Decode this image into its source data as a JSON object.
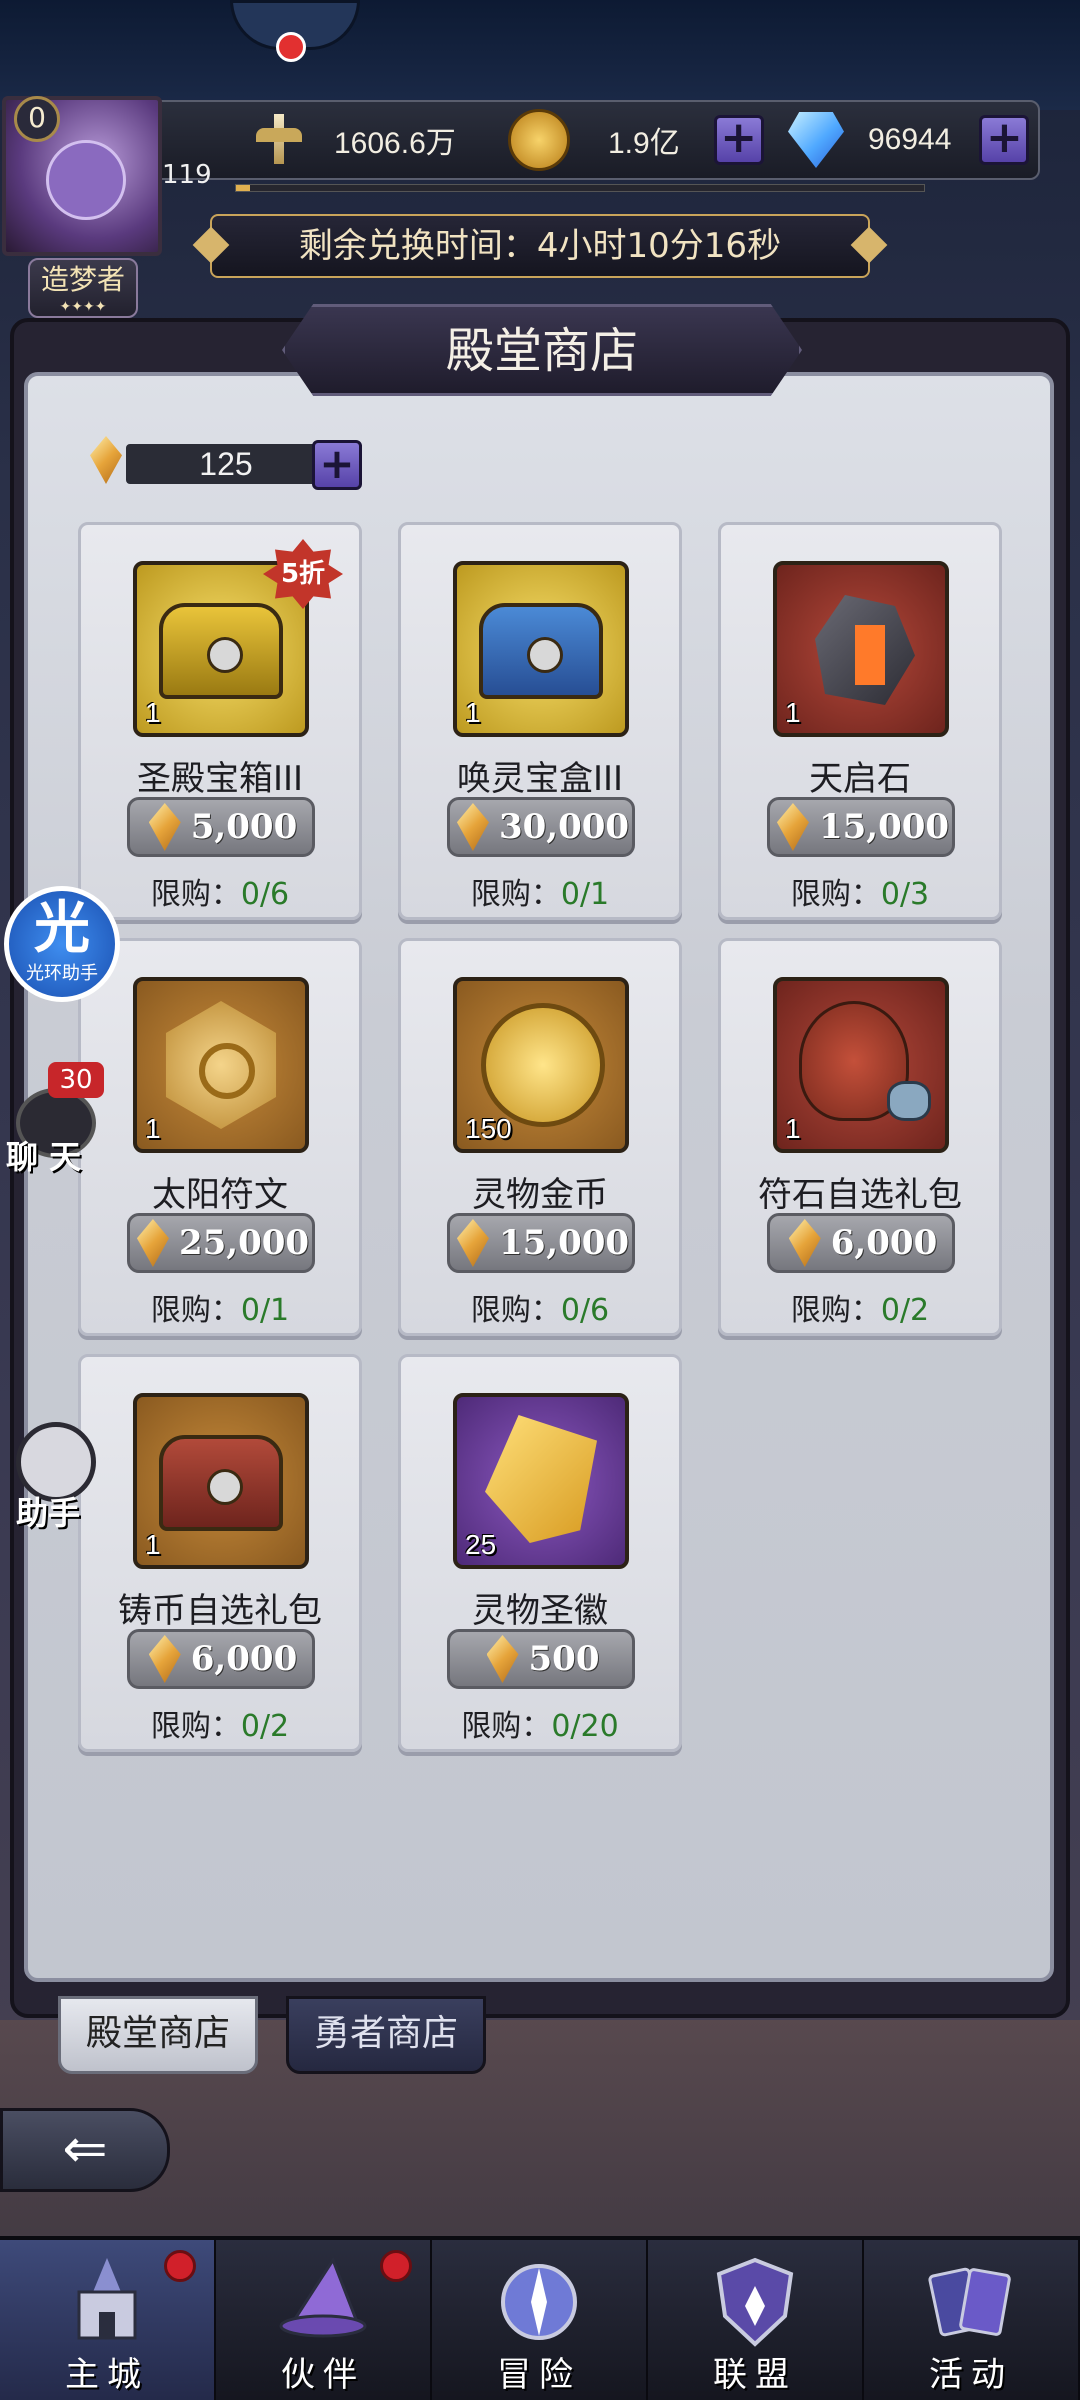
{
  "header": {
    "power": "1606.6万",
    "gold": "1.9亿",
    "diamonds": "96944",
    "level_badge": "0",
    "player_level": "119",
    "title": "造梦者",
    "title_stars": "✦✦✦✦",
    "xp_progress": 0.02
  },
  "timer": {
    "text": "剩余兑换时间：4小时10分16秒"
  },
  "shop": {
    "title": "殿堂商店",
    "currency_amount": "125",
    "items": [
      {
        "name": "圣殿宝箱III",
        "qty": "1",
        "price": "5,000",
        "limit_label": "限购：",
        "limit_value": "0/6",
        "discount": "5折",
        "icon": "yellow-chest-icon"
      },
      {
        "name": "唤灵宝盒III",
        "qty": "1",
        "price": "30,000",
        "limit_label": "限购：",
        "limit_value": "0/1",
        "icon": "blue-chest-icon"
      },
      {
        "name": "天启石",
        "qty": "1",
        "price": "15,000",
        "limit_label": "限购：",
        "limit_value": "0/3",
        "icon": "apocalypse-stone-icon"
      },
      {
        "name": "太阳符文",
        "qty": "1",
        "price": "25,000",
        "limit_label": "限购：",
        "limit_value": "0/1",
        "icon": "sun-rune-icon"
      },
      {
        "name": "灵物金币",
        "qty": "150",
        "price": "15,000",
        "limit_label": "限购：",
        "limit_value": "0/6",
        "icon": "spirit-coin-icon"
      },
      {
        "name": "符石自选礼包",
        "qty": "1",
        "price": "6,000",
        "limit_label": "限购：",
        "limit_value": "0/2",
        "icon": "rune-bag-icon"
      },
      {
        "name": "铸币自选礼包",
        "qty": "1",
        "price": "6,000",
        "limit_label": "限购：",
        "limit_value": "0/2",
        "icon": "red-chest-icon"
      },
      {
        "name": "灵物圣徽",
        "qty": "25",
        "price": "500",
        "limit_label": "限购：",
        "limit_value": "0/20",
        "icon": "spirit-emblem-icon"
      }
    ],
    "tabs": [
      "殿堂商店",
      "勇者商店"
    ]
  },
  "side": {
    "helper_big": "光",
    "helper_small": "光环助手",
    "chat_badge": "30",
    "chat_label": "聊 天",
    "assist_label": "助手"
  },
  "back_glyph": "⇐",
  "nav": [
    {
      "label": "主城",
      "dot": true
    },
    {
      "label": "伙伴",
      "dot": true
    },
    {
      "label": "冒险",
      "dot": false
    },
    {
      "label": "联盟",
      "dot": false
    },
    {
      "label": "活动",
      "dot": false
    }
  ]
}
